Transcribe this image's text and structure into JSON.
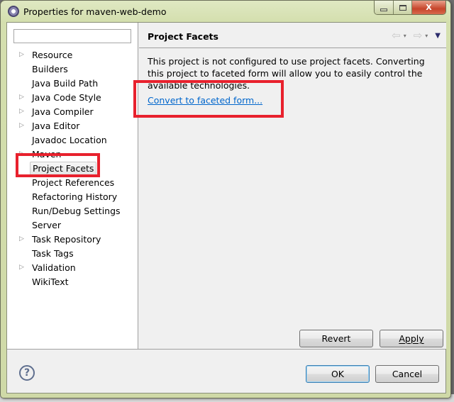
{
  "window": {
    "title": "Properties for maven-web-demo",
    "controls": {
      "minimize": "minimize",
      "maximize": "maximize",
      "close": "X"
    }
  },
  "tree": {
    "filter_placeholder": "",
    "filter_value": "",
    "items": [
      {
        "label": "Resource",
        "expandable": true
      },
      {
        "label": "Builders",
        "expandable": false
      },
      {
        "label": "Java Build Path",
        "expandable": false
      },
      {
        "label": "Java Code Style",
        "expandable": true
      },
      {
        "label": "Java Compiler",
        "expandable": true
      },
      {
        "label": "Java Editor",
        "expandable": true
      },
      {
        "label": "Javadoc Location",
        "expandable": false
      },
      {
        "label": "Maven",
        "expandable": true
      },
      {
        "label": "Project Facets",
        "expandable": false,
        "selected": true
      },
      {
        "label": "Project References",
        "expandable": false
      },
      {
        "label": "Refactoring History",
        "expandable": false
      },
      {
        "label": "Run/Debug Settings",
        "expandable": false
      },
      {
        "label": "Server",
        "expandable": false
      },
      {
        "label": "Task Repository",
        "expandable": true
      },
      {
        "label": "Task Tags",
        "expandable": false
      },
      {
        "label": "Validation",
        "expandable": true
      },
      {
        "label": "WikiText",
        "expandable": false
      }
    ]
  },
  "page": {
    "title": "Project Facets",
    "nav": {
      "back": "⇦",
      "forward": "⇨",
      "dropdown": "▾",
      "menu": "▼"
    },
    "description": "This project is not configured to use project facets. Converting this project to faceted form will allow you to easily control the available technologies.",
    "link": "Convert to faceted form..."
  },
  "buttons": {
    "revert": "Revert",
    "apply": "Apply",
    "ok": "OK",
    "cancel": "Cancel",
    "help": "?"
  },
  "colors": {
    "highlight": "#e8212d",
    "link": "#0066cc"
  }
}
